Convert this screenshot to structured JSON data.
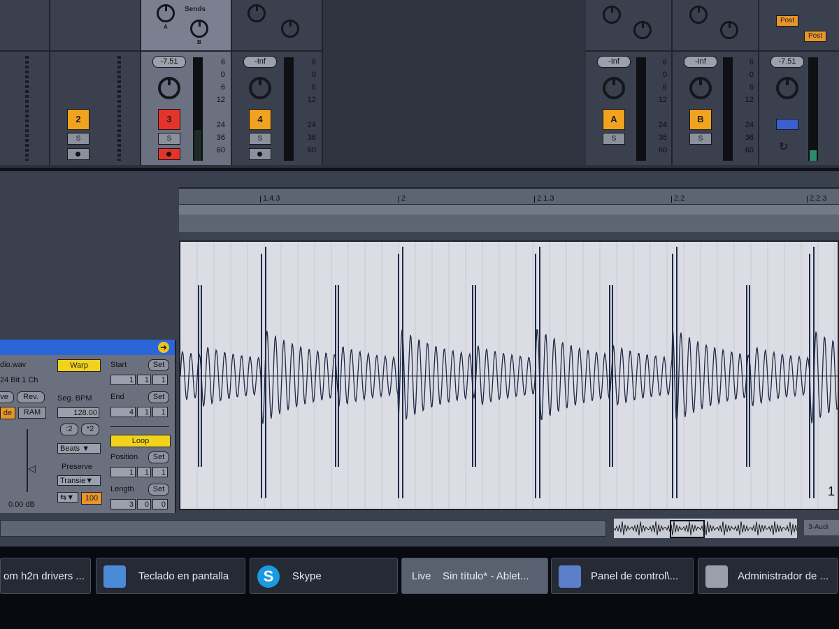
{
  "mixer": {
    "sends_label": "Sends",
    "knob_a": "A",
    "knob_b": "B",
    "post_label": "Post",
    "scale": [
      "6",
      "0",
      "6",
      "12",
      "24",
      "36",
      "60"
    ],
    "tracks": [
      {
        "number": "2",
        "solo": "S"
      },
      {
        "number": "3",
        "volume": "-7.51",
        "solo": "S"
      },
      {
        "number": "4",
        "volume": "-Inf",
        "solo": "S"
      }
    ],
    "returns": [
      {
        "number": "A",
        "volume": "-Inf",
        "solo": "S"
      },
      {
        "number": "B",
        "volume": "-Inf",
        "solo": "S"
      }
    ],
    "master": {
      "volume": "-7.51"
    }
  },
  "arrangement": {
    "ruler_ticks": [
      "1.4.3",
      "2",
      "2.1.3",
      "2.2",
      "2.2.3"
    ],
    "loop_number": "1"
  },
  "clip": {
    "filename": "dio.wav",
    "format": "24 Bit 1 Ch",
    "rev_label": "Rev.",
    "save_label": "ve",
    "ram_label": "RAM",
    "hide_label": "de",
    "warp_label": "Warp",
    "seg_bpm_label": "Seg. BPM",
    "bpm_value": "128.00",
    "half_label": ":2",
    "double_label": "*2",
    "warp_mode": "Beats",
    "preserve_label": "Preserve",
    "preserve_value": "Transie",
    "envelope_value": "100",
    "gain_value": "0.00 dB",
    "start_label": "Start",
    "end_label": "End",
    "set_label": "Set",
    "start_values": [
      "1",
      "1",
      "1"
    ],
    "end_values": [
      "4",
      "1",
      "1"
    ],
    "loop_label": "Loop",
    "position_label": "Position",
    "position_values": [
      "1",
      "1",
      "1"
    ],
    "length_label": "Length",
    "length_values": [
      "3",
      "0",
      "0"
    ]
  },
  "overview": {
    "track_label": "3-Audi"
  },
  "taskbar": {
    "items": [
      {
        "label": "om h2n drivers ..."
      },
      {
        "label": "Teclado en pantalla"
      },
      {
        "label": "Skype"
      },
      {
        "label": "Live",
        "sub": "Sin título* - Ablet..."
      },
      {
        "label": "Panel de control\\..."
      },
      {
        "label": "Administrador de ..."
      }
    ]
  },
  "colors": {
    "accent_orange": "#f1a21f",
    "record_red": "#e4342a",
    "loop_yellow": "#f3d21c",
    "clip_blue": "#2a66d8"
  }
}
